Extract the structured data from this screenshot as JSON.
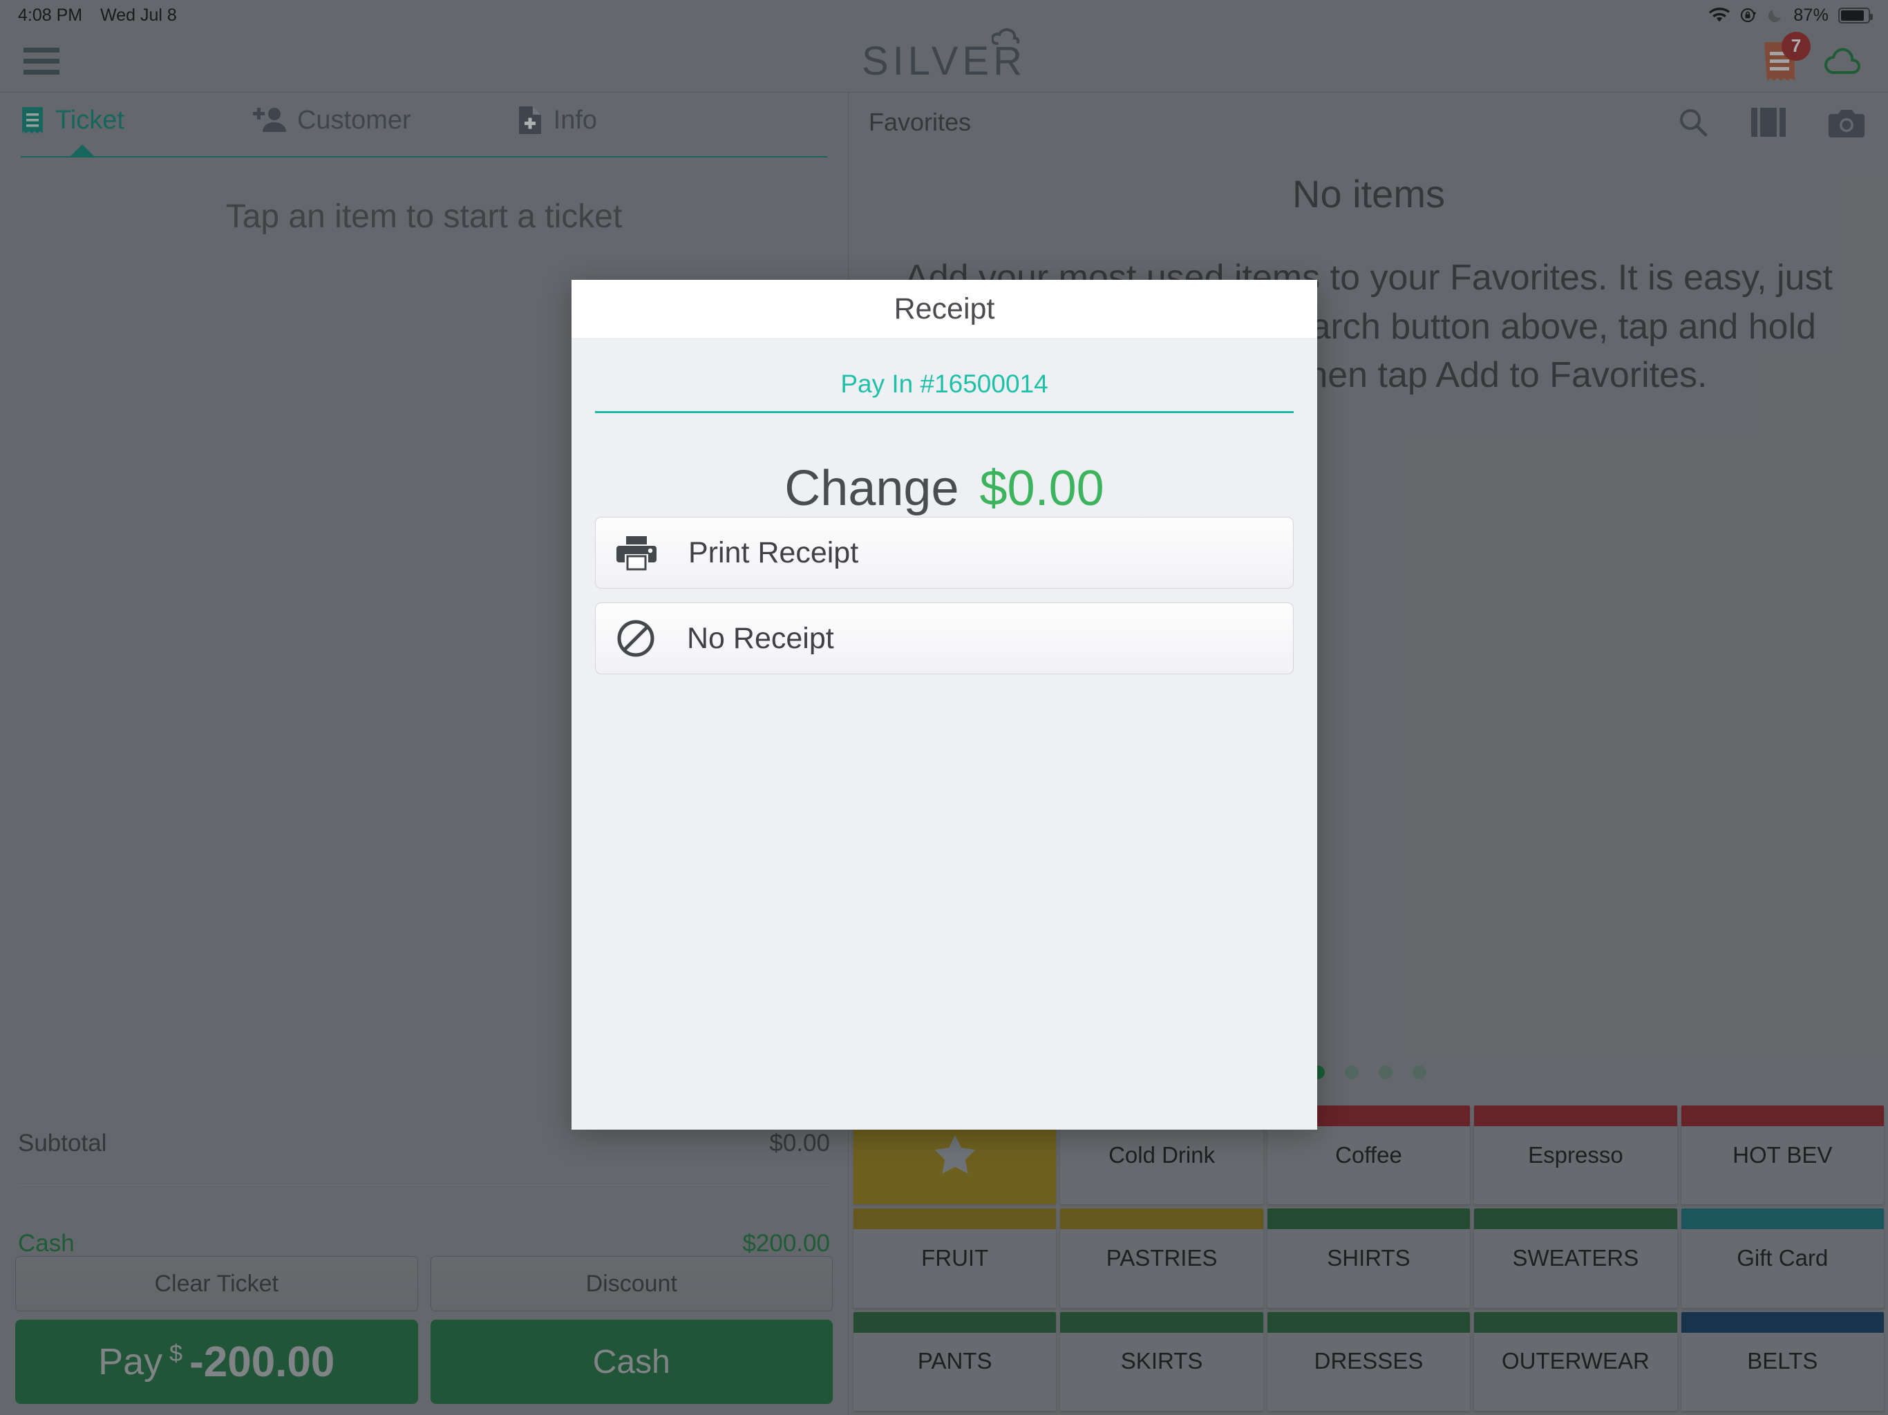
{
  "statusbar": {
    "time": "4:08 PM",
    "date": "Wed Jul 8",
    "battery_percent": "87%",
    "icons": [
      "wifi-icon",
      "rotation-lock-icon",
      "do-not-disturb-moon-icon",
      "battery-icon"
    ]
  },
  "topnav": {
    "brand": "SILVER",
    "menu_icon": "hamburger-menu-icon",
    "receipt_queue_icon": "receipt-queue-icon",
    "receipt_queue_count": "7",
    "cloud_icon": "cloud-sync-icon"
  },
  "left": {
    "tabs": [
      {
        "label": "Ticket",
        "icon": "ticket-icon",
        "active": true
      },
      {
        "label": "Customer",
        "icon": "add-customer-icon",
        "active": false
      },
      {
        "label": "Info",
        "icon": "add-info-document-icon",
        "active": false
      }
    ],
    "empty_message": "Tap an item to start a ticket",
    "totals": [
      {
        "label": "Subtotal",
        "value": "$0.00",
        "green": false
      },
      {
        "label": "Cash",
        "value": "$200.00",
        "green": true
      }
    ],
    "buttons": {
      "clear_ticket": "Clear Ticket",
      "discount": "Discount",
      "pay_label": "Pay",
      "pay_currency": "$",
      "pay_amount": "-200.00",
      "cash": "Cash"
    }
  },
  "right": {
    "header_title": "Favorites",
    "icons": [
      "search-icon",
      "layout-columns-icon",
      "camera-icon"
    ],
    "empty_title": "No items",
    "empty_body": "Add your most used items to your Favorites. It is easy, just find an item using the search button above, tap and hold on the item, and then tap Add to Favorites.",
    "page_dots": 4,
    "page_dot_active_index": 0,
    "categories": [
      {
        "label": "",
        "icon": "star-icon",
        "strip": "#9a8318",
        "tile": "#9a8318",
        "star": true
      },
      {
        "label": "Cold Drink",
        "strip": "#8e2026"
      },
      {
        "label": "Coffee",
        "strip": "#8e2026"
      },
      {
        "label": "Espresso",
        "strip": "#8e2026"
      },
      {
        "label": "HOT BEV",
        "strip": "#8e2026"
      },
      {
        "label": "FRUIT",
        "strip": "#8a7413"
      },
      {
        "label": "PASTRIES",
        "strip": "#8a7413"
      },
      {
        "label": "SHIRTS",
        "strip": "#216238"
      },
      {
        "label": "SWEATERS",
        "strip": "#216238"
      },
      {
        "label": "Gift Card",
        "strip": "#15707a"
      },
      {
        "label": "PANTS",
        "strip": "#216238"
      },
      {
        "label": "SKIRTS",
        "strip": "#216238"
      },
      {
        "label": "DRESSES",
        "strip": "#216238"
      },
      {
        "label": "OUTERWEAR",
        "strip": "#216238"
      },
      {
        "label": "BELTS",
        "strip": "#0d3a60"
      }
    ]
  },
  "modal": {
    "title": "Receipt",
    "reference": "Pay In #16500014",
    "change_label": "Change",
    "change_amount": "$0.00",
    "options": [
      {
        "label": "Print Receipt",
        "icon": "printer-icon"
      },
      {
        "label": "No Receipt",
        "icon": "no-receipt-prohibited-icon"
      }
    ]
  },
  "colors": {
    "accent_teal": "#0d8b7d",
    "link_teal": "#1ec0a8",
    "money_green": "#3cb45e",
    "pay_green": "#1d7040",
    "badge_red": "#a32a2a",
    "chrome_gray": "#8a8d91"
  }
}
